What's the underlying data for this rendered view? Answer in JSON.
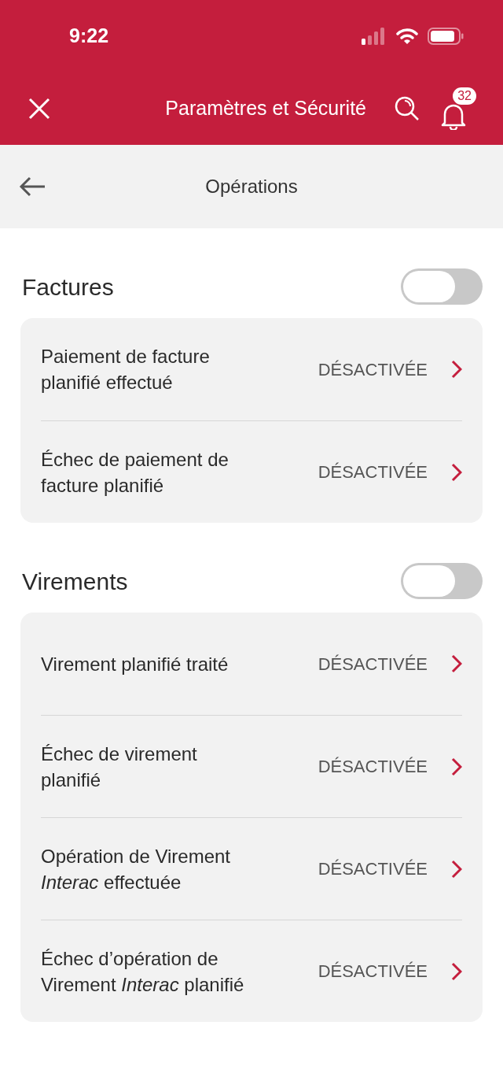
{
  "status_bar": {
    "time": "9:22"
  },
  "header": {
    "title": "Paramètres et Sécurité",
    "notification_count": "32"
  },
  "subheader": {
    "title": "Opérations"
  },
  "sections": [
    {
      "title": "Factures",
      "on": false,
      "rows": [
        {
          "label": "Paiement de facture planifié effectué",
          "status": "DÉSACTIVÉE"
        },
        {
          "label": "Échec de paiement de facture planifié",
          "status": "DÉSACTIVÉE"
        }
      ]
    },
    {
      "title": "Virements",
      "on": false,
      "rows": [
        {
          "label": "Virement planifié traité",
          "status": "DÉSACTIVÉE"
        },
        {
          "label": "Échec de virement planifié",
          "status": "DÉSACTIVÉE"
        },
        {
          "label": "Opération de Virement *Interac* effectuée",
          "status": "DÉSACTIVÉE"
        },
        {
          "label": "Échec d’opération de Virement *Interac* planifié",
          "status": "DÉSACTIVÉE"
        }
      ]
    }
  ]
}
